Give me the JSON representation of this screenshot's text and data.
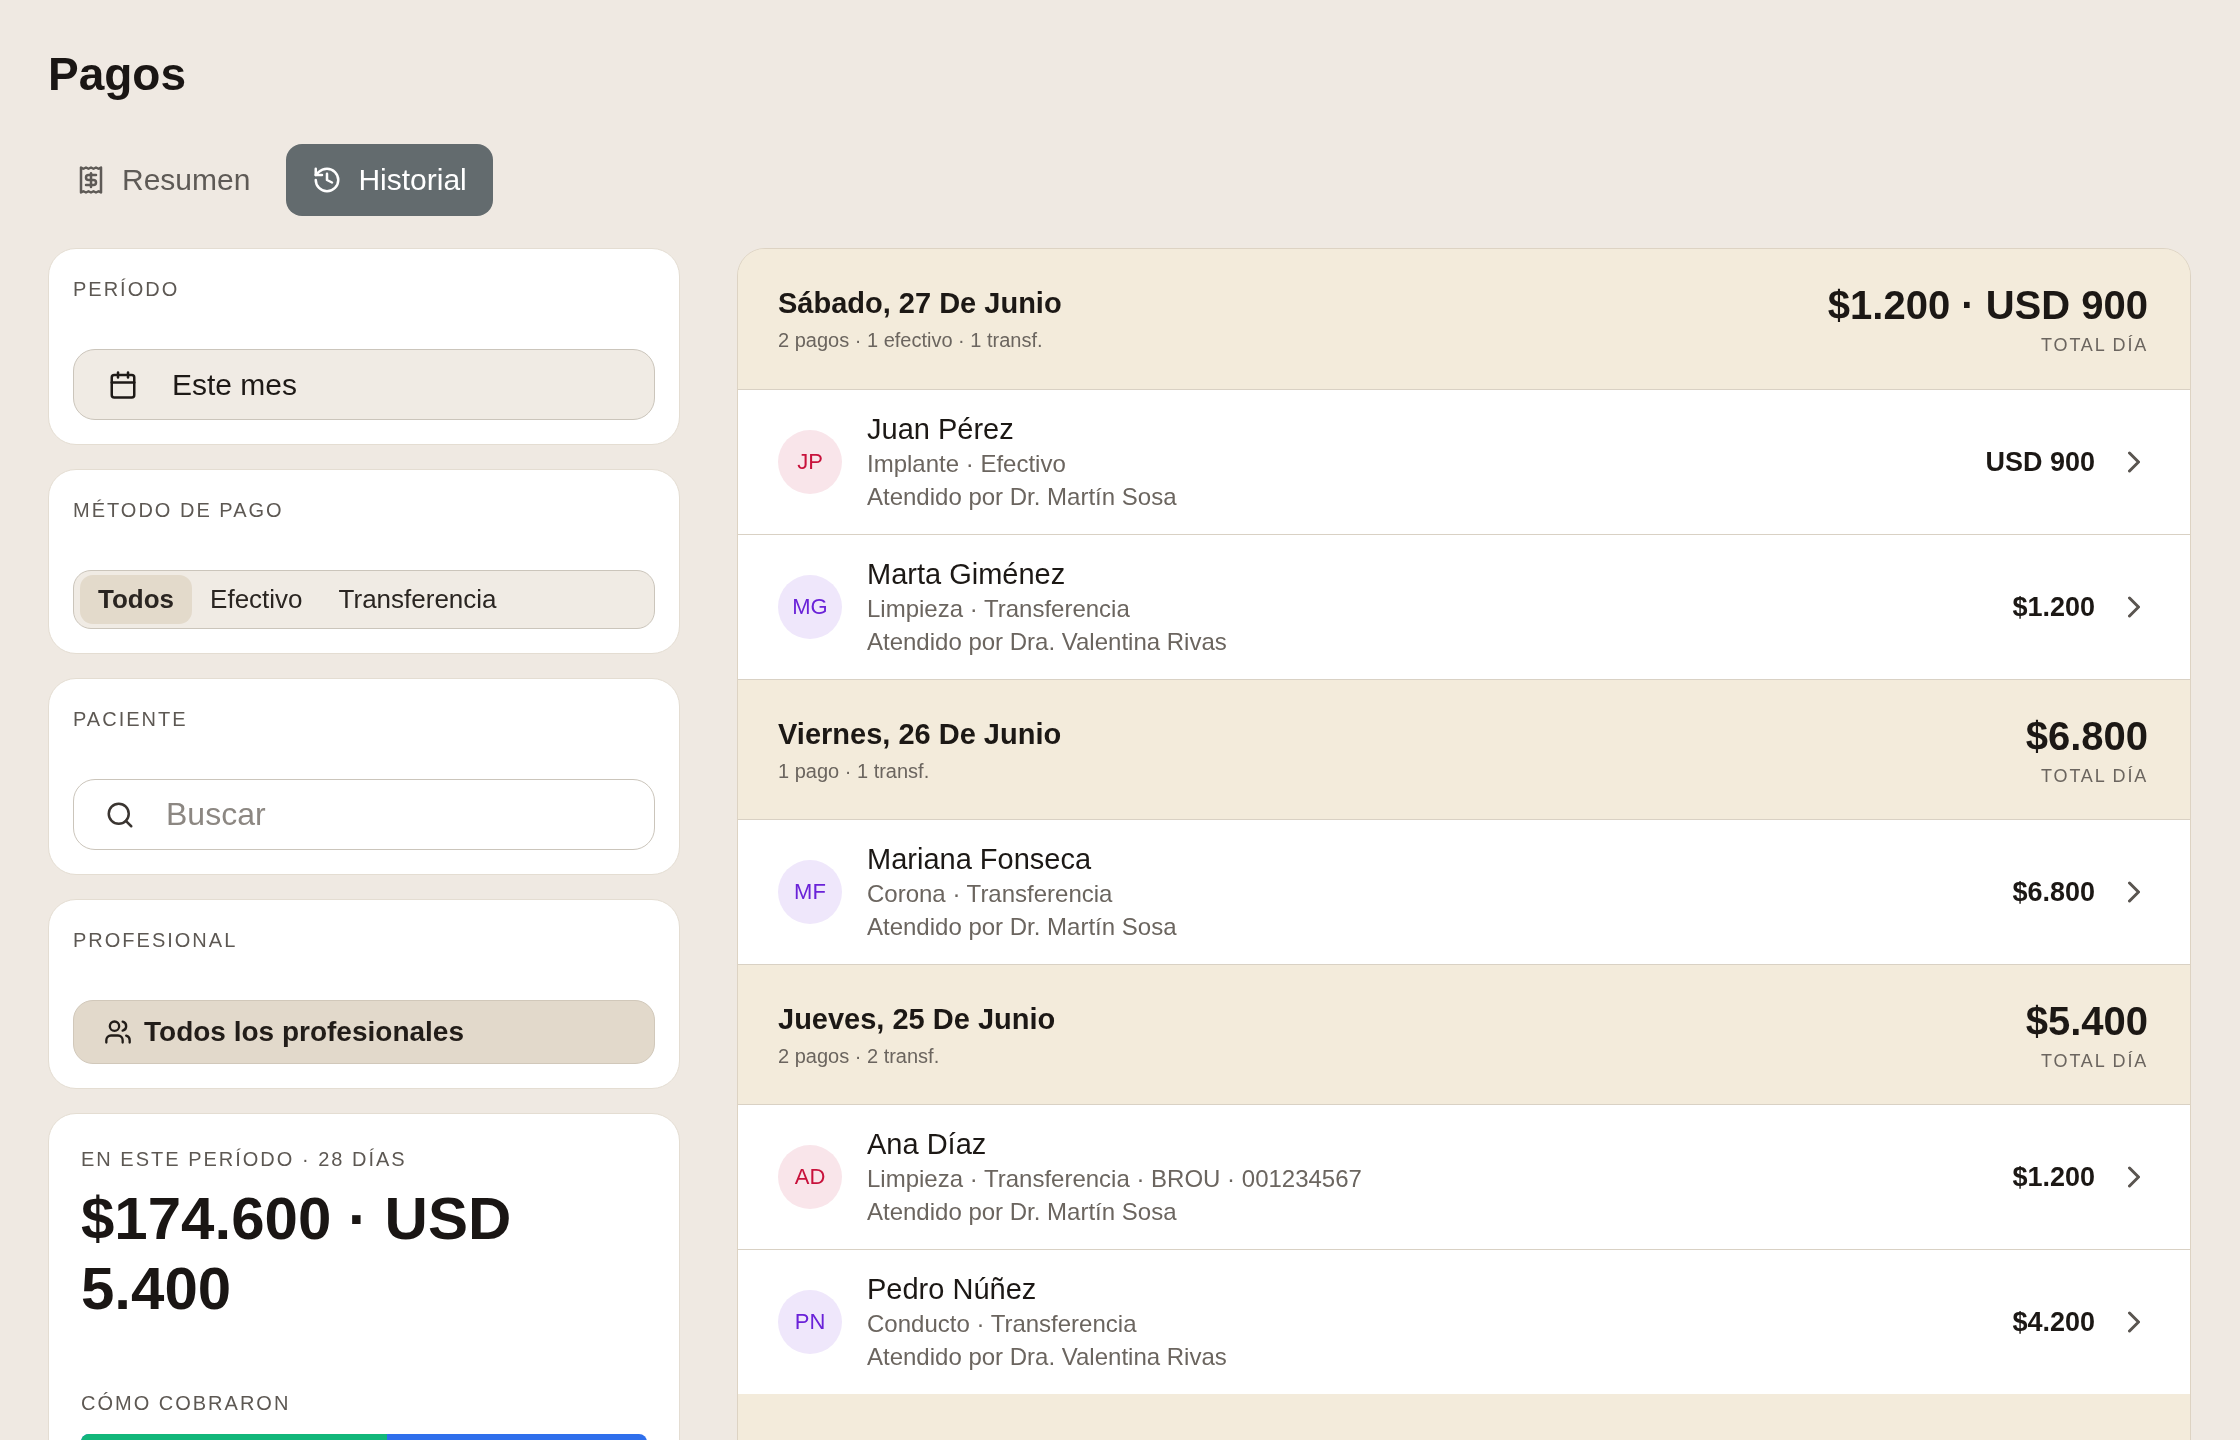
{
  "page": {
    "title": "Pagos"
  },
  "tabs": [
    {
      "label": "Resumen",
      "selected": false
    },
    {
      "label": "Historial",
      "selected": true
    }
  ],
  "filters": {
    "period": {
      "label": "PERÍODO",
      "value": "Este mes"
    },
    "payment_method": {
      "label": "MÉTODO DE PAGO",
      "options": [
        {
          "label": "Todos",
          "selected": true
        },
        {
          "label": "Efectivo",
          "selected": false
        },
        {
          "label": "Transferencia",
          "selected": false
        }
      ]
    },
    "patient": {
      "label": "PACIENTE",
      "placeholder": "Buscar"
    },
    "professional": {
      "label": "PROFESIONAL",
      "value": "Todos los profesionales"
    }
  },
  "summary": {
    "label": "EN ESTE PERÍODO · 28 DÍAS",
    "total": "$174.600 · USD 5.400",
    "breakdown_label": "CÓMO COBRARON",
    "breakdown_bar": {
      "level": 0.54
    }
  },
  "days": [
    {
      "title": "Sábado, 27 De Junio",
      "subtitle": "2 pagos · 1 efectivo · 1 transf.",
      "total": "$1.200 · USD 900",
      "total_label": "TOTAL DÍA",
      "payments": [
        {
          "initials": "JP",
          "color": "#c8123c",
          "name": "Juan Pérez",
          "details": "Implante · Efectivo",
          "attended_by": "Atendido por Dr. Martín Sosa",
          "amount": "USD 900"
        },
        {
          "initials": "MG",
          "color": "#6a22d8",
          "name": "Marta Giménez",
          "details": "Limpieza · Transferencia",
          "attended_by": "Atendido por Dra. Valentina Rivas",
          "amount": "$1.200"
        }
      ]
    },
    {
      "title": "Viernes, 26 De Junio",
      "subtitle": "1 pago · 1 transf.",
      "total": "$6.800",
      "total_label": "TOTAL DÍA",
      "payments": [
        {
          "initials": "MF",
          "color": "#6a22d8",
          "name": "Mariana Fonseca",
          "details": "Corona · Transferencia",
          "attended_by": "Atendido por Dr. Martín Sosa",
          "amount": "$6.800"
        }
      ]
    },
    {
      "title": "Jueves, 25 De Junio",
      "subtitle": "2 pagos · 2 transf.",
      "total": "$5.400",
      "total_label": "TOTAL DÍA",
      "payments": [
        {
          "initials": "AD",
          "color": "#c8123c",
          "name": "Ana Díaz",
          "details": "Limpieza · Transferencia · BROU · 001234567",
          "attended_by": "Atendido por Dr. Martín Sosa",
          "amount": "$1.200"
        },
        {
          "initials": "PN",
          "color": "#6a22d8",
          "name": "Pedro Núñez",
          "details": "Conducto · Transferencia",
          "attended_by": "Atendido por Dra. Valentina Rivas",
          "amount": "$4.200"
        }
      ]
    }
  ]
}
